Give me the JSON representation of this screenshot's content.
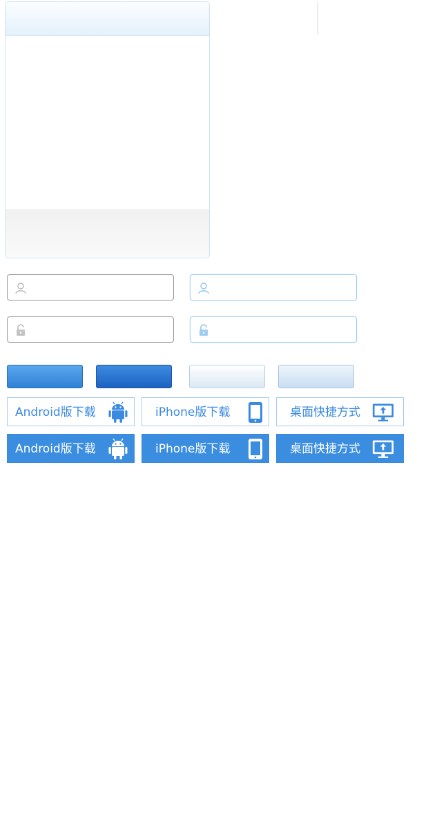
{
  "login": {
    "username_placeholder": "",
    "password_placeholder": ""
  },
  "icons": {
    "user": "user-icon",
    "lock": "lock-icon",
    "android": "android-icon",
    "phone": "smartphone-icon",
    "desktop": "desktop-shortcut-icon"
  },
  "downloads": [
    {
      "label": "Android版下载"
    },
    {
      "label": "iPhone版下载"
    },
    {
      "label": "桌面快捷方式"
    }
  ],
  "colors": {
    "accent": "#3b8ddf",
    "field_border_gray": "#9a9a9a",
    "field_border_blue": "#a6d0f2"
  }
}
